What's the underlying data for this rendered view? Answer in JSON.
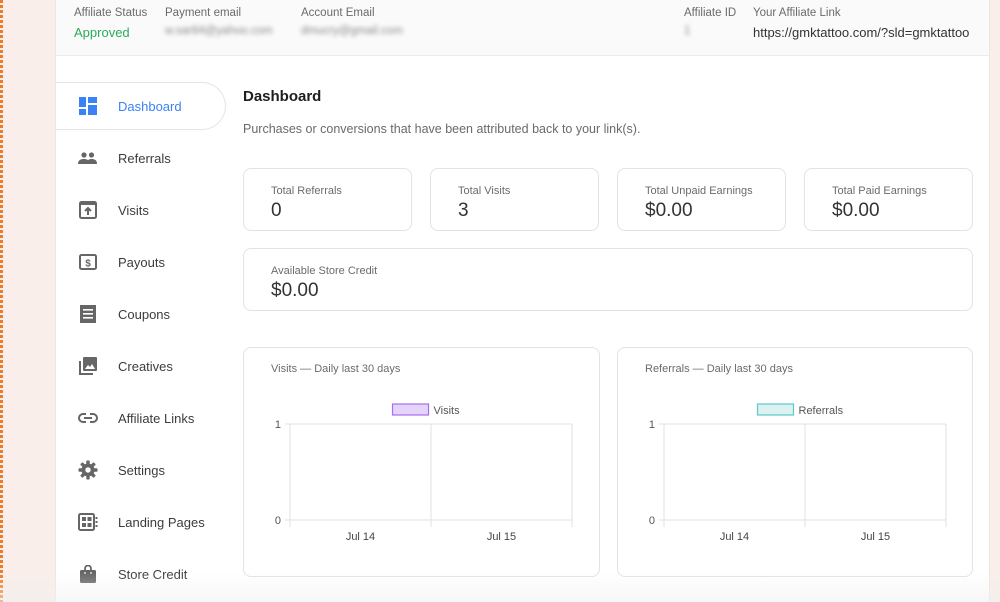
{
  "header": {
    "affiliate_status": {
      "label": "Affiliate Status",
      "value": "Approved",
      "color": "#2bab5b"
    },
    "payment_email": {
      "label": "Payment email",
      "value": "w.sar84@yahoo.com"
    },
    "account_email": {
      "label": "Account Email",
      "value": "dmucry@gmail.com"
    },
    "affiliate_id": {
      "label": "Affiliate ID",
      "value": "1"
    },
    "affiliate_link": {
      "label": "Your Affiliate Link",
      "value": "https://gmktattoo.com/?sld=gmktattoo"
    }
  },
  "sidebar": {
    "accent": "#3b82f6",
    "items": [
      {
        "label": "Dashboard",
        "icon": "dashboard-icon",
        "active": true
      },
      {
        "label": "Referrals",
        "icon": "people-icon"
      },
      {
        "label": "Visits",
        "icon": "upload-window-icon"
      },
      {
        "label": "Payouts",
        "icon": "dollar-bill-icon"
      },
      {
        "label": "Coupons",
        "icon": "receipt-icon"
      },
      {
        "label": "Creatives",
        "icon": "image-stack-icon"
      },
      {
        "label": "Affiliate Links",
        "icon": "link-icon"
      },
      {
        "label": "Settings",
        "icon": "gear-icon"
      },
      {
        "label": "Landing Pages",
        "icon": "landing-page-icon"
      },
      {
        "label": "Store Credit",
        "icon": "shopping-bag-icon"
      }
    ]
  },
  "main": {
    "title": "Dashboard",
    "description": "Purchases or conversions that have been attributed back to your link(s).",
    "stats": [
      {
        "label": "Total Referrals",
        "value": "0"
      },
      {
        "label": "Total Visits",
        "value": "3"
      },
      {
        "label": "Total Unpaid Earnings",
        "value": "$0.00"
      },
      {
        "label": "Total Paid Earnings",
        "value": "$0.00"
      }
    ],
    "store_credit": {
      "label": "Available Store Credit",
      "value": "$0.00"
    }
  },
  "chart_data": [
    {
      "type": "line",
      "title": "Visits — Daily last 30 days",
      "x": [
        "Jul 14",
        "Jul 15"
      ],
      "series": [
        {
          "name": "Visits",
          "values": [
            0,
            0
          ],
          "color": "#a86ef0",
          "fill": "#e4d4fb"
        }
      ],
      "ylim": [
        0,
        1
      ],
      "yticks": [
        "0",
        "1"
      ],
      "grid": true,
      "legend": "top-center",
      "xlabel": "",
      "ylabel": ""
    },
    {
      "type": "line",
      "title": "Referrals — Daily last 30 days",
      "x": [
        "Jul 14",
        "Jul 15"
      ],
      "series": [
        {
          "name": "Referrals",
          "values": [
            0,
            0
          ],
          "color": "#5cc8c8",
          "fill": "#dcf1f1"
        }
      ],
      "ylim": [
        0,
        1
      ],
      "yticks": [
        "0",
        "1"
      ],
      "grid": true,
      "legend": "top-center",
      "xlabel": "",
      "ylabel": ""
    }
  ]
}
